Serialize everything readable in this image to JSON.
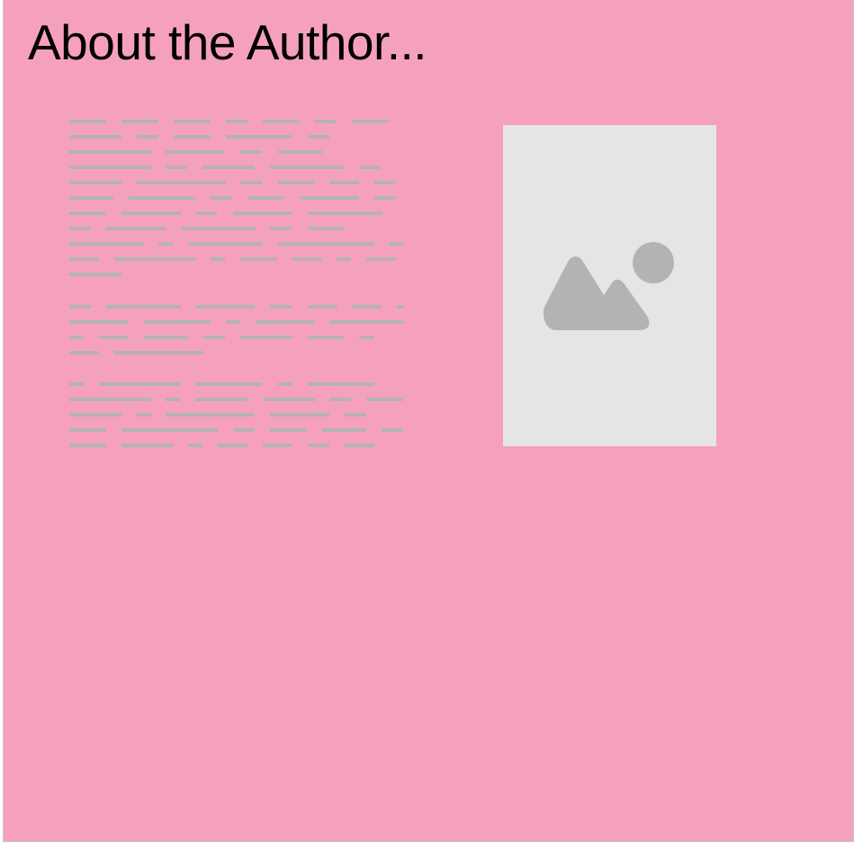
{
  "page": {
    "title": "About the Author..."
  },
  "colors": {
    "background": "#f6a1bc",
    "placeholder_bar": "#b3b3b3",
    "image_bg": "#e5e5e5",
    "image_icon": "#b3b3b3"
  },
  "icons": {
    "author_photo": "image-placeholder-icon"
  }
}
